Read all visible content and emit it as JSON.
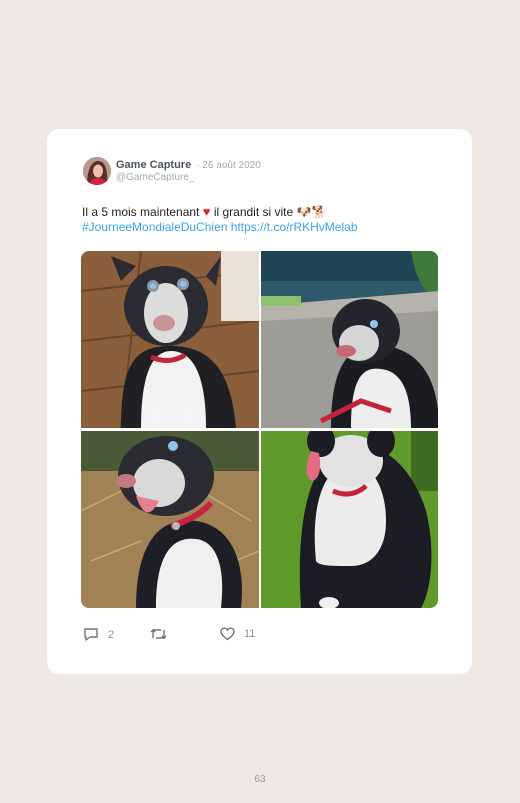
{
  "tweet": {
    "author_name": "Game Capture",
    "date": "· 26 août 2020",
    "handle": "@GameCapture_",
    "text_before_heart": "Il a 5 mois maintenant",
    "text_after_heart": "il grandit si vite 🐶🐕",
    "hashtag": "#JourneeMondialeDuChien",
    "link": "https://t.co/rRKHvMelab"
  },
  "actions": {
    "replies": "2",
    "likes": "11"
  },
  "page_number": "63",
  "colors": {
    "background": "#efe8e5",
    "card": "#ffffff",
    "link": "#3ba0e8",
    "heart": "#d22b3a"
  },
  "icons": [
    "reply-icon",
    "retweet-icon",
    "like-icon",
    "heart-emoji-icon"
  ]
}
